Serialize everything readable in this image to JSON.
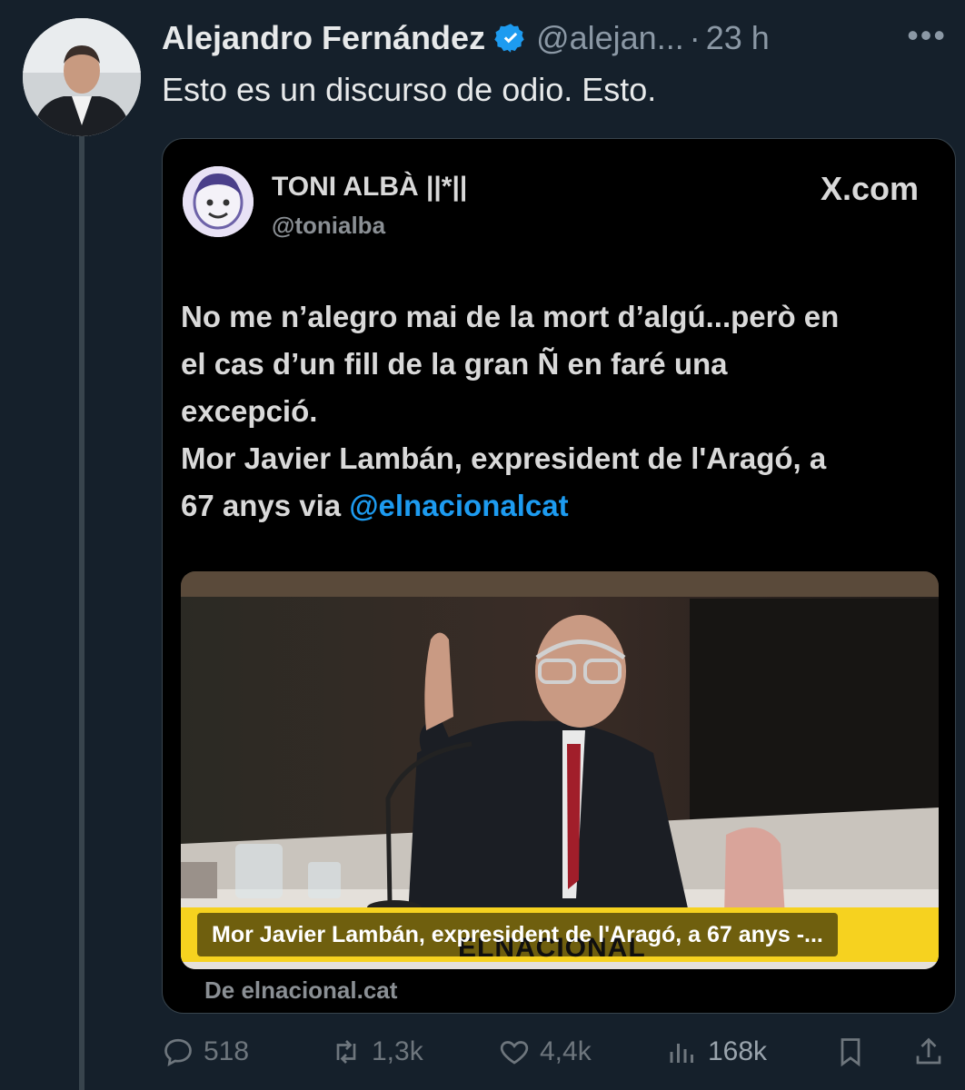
{
  "tweet": {
    "author_name": "Alejandro Fernández",
    "handle": "@alejan...",
    "separator": "·",
    "time": "23 h",
    "more_icon": "more-icon",
    "text": "Esto es un discurso de odio. Esto."
  },
  "quoted": {
    "name": "TONI ALBÀ ||*||",
    "handle": "@tonialba",
    "brand": "X.com",
    "text_line1": "No me n’alegro mai de la mort d’algú...però en",
    "text_line2": "el cas d’un fill de la gran Ñ en faré una",
    "text_line3": "excepció.",
    "text_line4": "Mor Javier Lambán, expresident de l'Aragó, a",
    "text_line5_prefix": "67 anys via ",
    "mention": "@elnacionalcat",
    "image_caption": "Mor Javier Lambán, expresident de l'Aragó, a 67 anys -...",
    "image_brand": "ELNACIONAL",
    "source": "De elnacional.cat"
  },
  "actions": {
    "replies": "518",
    "reposts": "1,3k",
    "likes": "4,4k",
    "views": "168k"
  },
  "colors": {
    "background": "#15202b",
    "accent": "#1d9bf0",
    "muted": "#8b98a5",
    "caption_yellow": "#f6d21f"
  }
}
